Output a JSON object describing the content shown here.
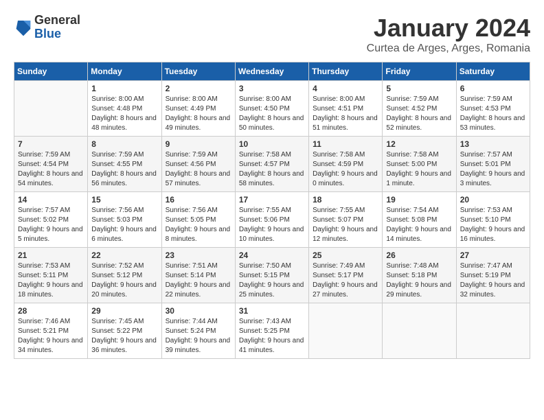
{
  "logo": {
    "general": "General",
    "blue": "Blue"
  },
  "title": {
    "month": "January 2024",
    "location": "Curtea de Arges, Arges, Romania"
  },
  "days_of_week": [
    "Sunday",
    "Monday",
    "Tuesday",
    "Wednesday",
    "Thursday",
    "Friday",
    "Saturday"
  ],
  "weeks": [
    [
      {
        "day": "",
        "sunrise": "",
        "sunset": "",
        "daylight": ""
      },
      {
        "day": "1",
        "sunrise": "Sunrise: 8:00 AM",
        "sunset": "Sunset: 4:48 PM",
        "daylight": "Daylight: 8 hours and 48 minutes."
      },
      {
        "day": "2",
        "sunrise": "Sunrise: 8:00 AM",
        "sunset": "Sunset: 4:49 PM",
        "daylight": "Daylight: 8 hours and 49 minutes."
      },
      {
        "day": "3",
        "sunrise": "Sunrise: 8:00 AM",
        "sunset": "Sunset: 4:50 PM",
        "daylight": "Daylight: 8 hours and 50 minutes."
      },
      {
        "day": "4",
        "sunrise": "Sunrise: 8:00 AM",
        "sunset": "Sunset: 4:51 PM",
        "daylight": "Daylight: 8 hours and 51 minutes."
      },
      {
        "day": "5",
        "sunrise": "Sunrise: 7:59 AM",
        "sunset": "Sunset: 4:52 PM",
        "daylight": "Daylight: 8 hours and 52 minutes."
      },
      {
        "day": "6",
        "sunrise": "Sunrise: 7:59 AM",
        "sunset": "Sunset: 4:53 PM",
        "daylight": "Daylight: 8 hours and 53 minutes."
      }
    ],
    [
      {
        "day": "7",
        "sunrise": "Sunrise: 7:59 AM",
        "sunset": "Sunset: 4:54 PM",
        "daylight": "Daylight: 8 hours and 54 minutes."
      },
      {
        "day": "8",
        "sunrise": "Sunrise: 7:59 AM",
        "sunset": "Sunset: 4:55 PM",
        "daylight": "Daylight: 8 hours and 56 minutes."
      },
      {
        "day": "9",
        "sunrise": "Sunrise: 7:59 AM",
        "sunset": "Sunset: 4:56 PM",
        "daylight": "Daylight: 8 hours and 57 minutes."
      },
      {
        "day": "10",
        "sunrise": "Sunrise: 7:58 AM",
        "sunset": "Sunset: 4:57 PM",
        "daylight": "Daylight: 8 hours and 58 minutes."
      },
      {
        "day": "11",
        "sunrise": "Sunrise: 7:58 AM",
        "sunset": "Sunset: 4:59 PM",
        "daylight": "Daylight: 9 hours and 0 minutes."
      },
      {
        "day": "12",
        "sunrise": "Sunrise: 7:58 AM",
        "sunset": "Sunset: 5:00 PM",
        "daylight": "Daylight: 9 hours and 1 minute."
      },
      {
        "day": "13",
        "sunrise": "Sunrise: 7:57 AM",
        "sunset": "Sunset: 5:01 PM",
        "daylight": "Daylight: 9 hours and 3 minutes."
      }
    ],
    [
      {
        "day": "14",
        "sunrise": "Sunrise: 7:57 AM",
        "sunset": "Sunset: 5:02 PM",
        "daylight": "Daylight: 9 hours and 5 minutes."
      },
      {
        "day": "15",
        "sunrise": "Sunrise: 7:56 AM",
        "sunset": "Sunset: 5:03 PM",
        "daylight": "Daylight: 9 hours and 6 minutes."
      },
      {
        "day": "16",
        "sunrise": "Sunrise: 7:56 AM",
        "sunset": "Sunset: 5:05 PM",
        "daylight": "Daylight: 9 hours and 8 minutes."
      },
      {
        "day": "17",
        "sunrise": "Sunrise: 7:55 AM",
        "sunset": "Sunset: 5:06 PM",
        "daylight": "Daylight: 9 hours and 10 minutes."
      },
      {
        "day": "18",
        "sunrise": "Sunrise: 7:55 AM",
        "sunset": "Sunset: 5:07 PM",
        "daylight": "Daylight: 9 hours and 12 minutes."
      },
      {
        "day": "19",
        "sunrise": "Sunrise: 7:54 AM",
        "sunset": "Sunset: 5:08 PM",
        "daylight": "Daylight: 9 hours and 14 minutes."
      },
      {
        "day": "20",
        "sunrise": "Sunrise: 7:53 AM",
        "sunset": "Sunset: 5:10 PM",
        "daylight": "Daylight: 9 hours and 16 minutes."
      }
    ],
    [
      {
        "day": "21",
        "sunrise": "Sunrise: 7:53 AM",
        "sunset": "Sunset: 5:11 PM",
        "daylight": "Daylight: 9 hours and 18 minutes."
      },
      {
        "day": "22",
        "sunrise": "Sunrise: 7:52 AM",
        "sunset": "Sunset: 5:12 PM",
        "daylight": "Daylight: 9 hours and 20 minutes."
      },
      {
        "day": "23",
        "sunrise": "Sunrise: 7:51 AM",
        "sunset": "Sunset: 5:14 PM",
        "daylight": "Daylight: 9 hours and 22 minutes."
      },
      {
        "day": "24",
        "sunrise": "Sunrise: 7:50 AM",
        "sunset": "Sunset: 5:15 PM",
        "daylight": "Daylight: 9 hours and 25 minutes."
      },
      {
        "day": "25",
        "sunrise": "Sunrise: 7:49 AM",
        "sunset": "Sunset: 5:17 PM",
        "daylight": "Daylight: 9 hours and 27 minutes."
      },
      {
        "day": "26",
        "sunrise": "Sunrise: 7:48 AM",
        "sunset": "Sunset: 5:18 PM",
        "daylight": "Daylight: 9 hours and 29 minutes."
      },
      {
        "day": "27",
        "sunrise": "Sunrise: 7:47 AM",
        "sunset": "Sunset: 5:19 PM",
        "daylight": "Daylight: 9 hours and 32 minutes."
      }
    ],
    [
      {
        "day": "28",
        "sunrise": "Sunrise: 7:46 AM",
        "sunset": "Sunset: 5:21 PM",
        "daylight": "Daylight: 9 hours and 34 minutes."
      },
      {
        "day": "29",
        "sunrise": "Sunrise: 7:45 AM",
        "sunset": "Sunset: 5:22 PM",
        "daylight": "Daylight: 9 hours and 36 minutes."
      },
      {
        "day": "30",
        "sunrise": "Sunrise: 7:44 AM",
        "sunset": "Sunset: 5:24 PM",
        "daylight": "Daylight: 9 hours and 39 minutes."
      },
      {
        "day": "31",
        "sunrise": "Sunrise: 7:43 AM",
        "sunset": "Sunset: 5:25 PM",
        "daylight": "Daylight: 9 hours and 41 minutes."
      },
      {
        "day": "",
        "sunrise": "",
        "sunset": "",
        "daylight": ""
      },
      {
        "day": "",
        "sunrise": "",
        "sunset": "",
        "daylight": ""
      },
      {
        "day": "",
        "sunrise": "",
        "sunset": "",
        "daylight": ""
      }
    ]
  ]
}
